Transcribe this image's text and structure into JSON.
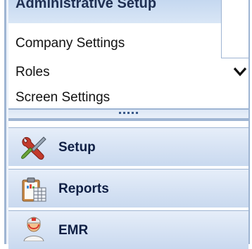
{
  "submenu": {
    "header": "Administrative Setup",
    "items": [
      {
        "label": "Company Settings"
      },
      {
        "label": "Roles"
      },
      {
        "label": "Screen Settings"
      }
    ]
  },
  "nav": {
    "items": [
      {
        "label": "Setup",
        "icon": "setup-tools-icon"
      },
      {
        "label": "Reports",
        "icon": "reports-clipboard-icon"
      },
      {
        "label": "EMR",
        "icon": "emr-doctor-icon"
      }
    ]
  },
  "colors": {
    "border": "#9fb5d3",
    "header_bg": "#c5d8f0",
    "button_bg": "#d7e3f4",
    "label_text": "#0f1f44"
  }
}
